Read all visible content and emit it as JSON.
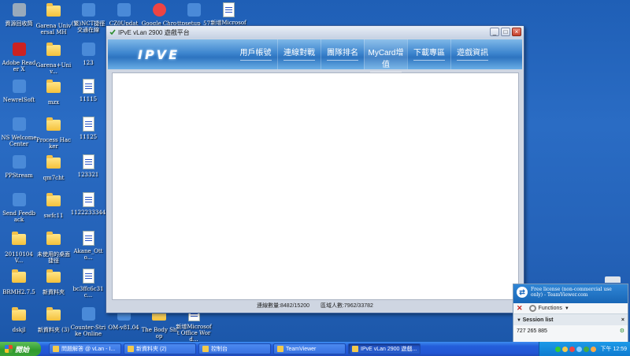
{
  "desktop": {
    "icons": [
      {
        "label": "資源回收筒",
        "type": "recycle"
      },
      {
        "label": "Garena Universal MH",
        "type": "folder"
      },
      {
        "label": "(繁)NCT捷徑交通在線",
        "type": "app"
      },
      {
        "label": "CZ0Update...",
        "type": "app"
      },
      {
        "label": "Google Chrome",
        "type": "chrome"
      },
      {
        "label": "ttpsetup_571...",
        "type": "app"
      },
      {
        "label": "新增Microsoft",
        "type": "doc"
      },
      {
        "label": "Adobe Reader X",
        "type": "pdf"
      },
      {
        "label": "Garena+Univ...",
        "type": "folder"
      },
      {
        "label": "123",
        "type": "app"
      },
      {
        "label": "NewrelSoft",
        "type": "app"
      },
      {
        "label": "mzx",
        "type": "folder"
      },
      {
        "label": "11115",
        "type": "doc"
      },
      {
        "label": "NS Welcome Center",
        "type": "app"
      },
      {
        "label": "Process Hacker",
        "type": "folder"
      },
      {
        "label": "11125",
        "type": "doc"
      },
      {
        "label": "PPStream",
        "type": "app"
      },
      {
        "label": "qm7cht",
        "type": "folder"
      },
      {
        "label": "123321",
        "type": "doc"
      },
      {
        "label": "Send Feedback",
        "type": "app"
      },
      {
        "label": "swfc11",
        "type": "folder"
      },
      {
        "label": "1122233344",
        "type": "doc"
      },
      {
        "label": "20110104V...",
        "type": "folder"
      },
      {
        "label": "未使用的桌面捷徑",
        "type": "folder"
      },
      {
        "label": "Akane_Otto...",
        "type": "doc"
      },
      {
        "label": "BRMH2.7.5",
        "type": "folder"
      },
      {
        "label": "新資料夾",
        "type": "folder"
      },
      {
        "label": "bc3ffc6c31c...",
        "type": "doc"
      },
      {
        "label": "dskjl",
        "type": "folder"
      },
      {
        "label": "新資料夾 (3)",
        "type": "folder"
      },
      {
        "label": "Counter-Strike Online",
        "type": "app"
      },
      {
        "label": "OM-v81.04",
        "type": "app"
      },
      {
        "label": "The Body Shop",
        "type": "folder"
      },
      {
        "label": "新增Microsoft Office Word...",
        "type": "doc"
      }
    ]
  },
  "window": {
    "title": "IPvE vLan 2900 遊戲平台",
    "logo": "IPVE",
    "nav": [
      "用戶帳號",
      "連線對戰",
      "團隊排名",
      "MyCard增值",
      "下載專區",
      "遊戲資訊"
    ],
    "status_connections": "連線數量:8482/15200",
    "status_online": "區域人數:7962/33782"
  },
  "teamviewer": {
    "notice": "Free license (non-commercial use only) - TeamViewer.com",
    "functions_label": "Functions",
    "session_list_label": "Session list",
    "session_id": "727 265 885"
  },
  "taskbar": {
    "start_label": "開始",
    "tasks": [
      {
        "label": "問題解答 @ vLan - I...",
        "active": false
      },
      {
        "label": "新資料夾 (2)",
        "active": false
      },
      {
        "label": "控制台",
        "active": false
      },
      {
        "label": "TeamViewer",
        "active": false
      },
      {
        "label": "IPvE vLan 2900 遊戲...",
        "active": true
      }
    ],
    "clock": "下午 12:59"
  }
}
